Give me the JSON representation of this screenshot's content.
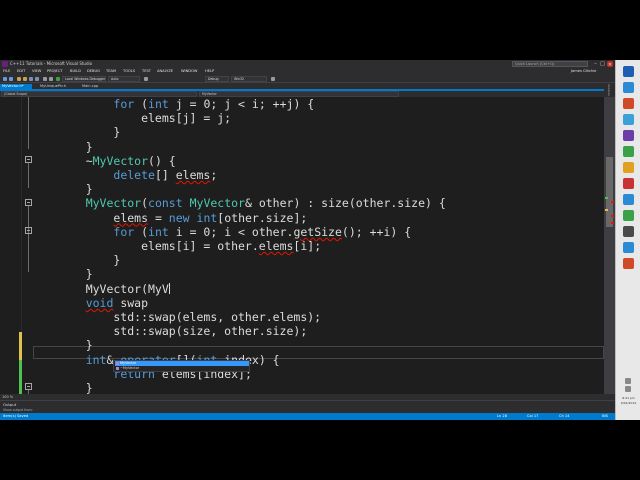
{
  "window": {
    "title": "C++11 Tutorials - Microsoft Visual Studio",
    "quick_launch_placeholder": "Quick Launch (Ctrl+Q)",
    "user": "James Clitchie",
    "minimize": "–",
    "maximize": "□",
    "close": "✕"
  },
  "menu": [
    "FILE",
    "EDIT",
    "VIEW",
    "PROJECT",
    "BUILD",
    "DEBUG",
    "TEAM",
    "TOOLS",
    "TEST",
    "ANALYZE",
    "WINDOW",
    "HELP"
  ],
  "toolbar": {
    "debugger": "Local Windows Debugger",
    "build_config": "Debug",
    "platform": "Win32",
    "auto_label": "Auto"
  },
  "tabs": [
    {
      "label": "MyVector.h*",
      "active": true
    },
    {
      "label": "MyUniquePtr.h",
      "active": false
    },
    {
      "label": "Main.cpp",
      "active": false
    }
  ],
  "navbar": {
    "scope": "(Global Scope)",
    "member": "MyVector"
  },
  "side_panel": {
    "label": "Solution Explorer"
  },
  "code_lines": [
    "        for (int j = 0; j < i; ++j) {",
    "            elems[j] = j;",
    "        }",
    "    }",
    "    ~MyVector() {",
    "        delete[] elems;",
    "    }",
    "    MyVector(const MyVector& other) : size(other.size) {",
    "        elems = new int[other.size];",
    "        for (int i = 0; i < other.getSize(); ++i) {",
    "            elems[i] = other.elems[i];",
    "        }",
    "    }",
    "    MyVector(MyV",
    "    void swap",
    "        std::swap(elems, other.elems);",
    "        std::swap(size, other.size);",
    "    }",
    "    int& operator[](int index) {",
    "        return elems[index];",
    "    }"
  ],
  "intellisense": [
    {
      "label": "MyVector",
      "selected": true
    },
    {
      "label": "~MyVector",
      "selected": false
    }
  ],
  "zoom": "100 %",
  "output": {
    "title": "Output",
    "show_from": "Show output from:"
  },
  "status": {
    "ready": "Item(s) Saved",
    "line": "Ln 28",
    "col": "Col 17",
    "ch": "Ch 14",
    "mode": "INS"
  },
  "clock": {
    "time": "8:41 pm",
    "date": "9/01/2014"
  },
  "colors": {
    "accent": "#007acc",
    "keyword": "#569cd6",
    "type": "#4ec9b0",
    "editor_bg": "#1e1e1e",
    "squiggle": "#e51400"
  }
}
